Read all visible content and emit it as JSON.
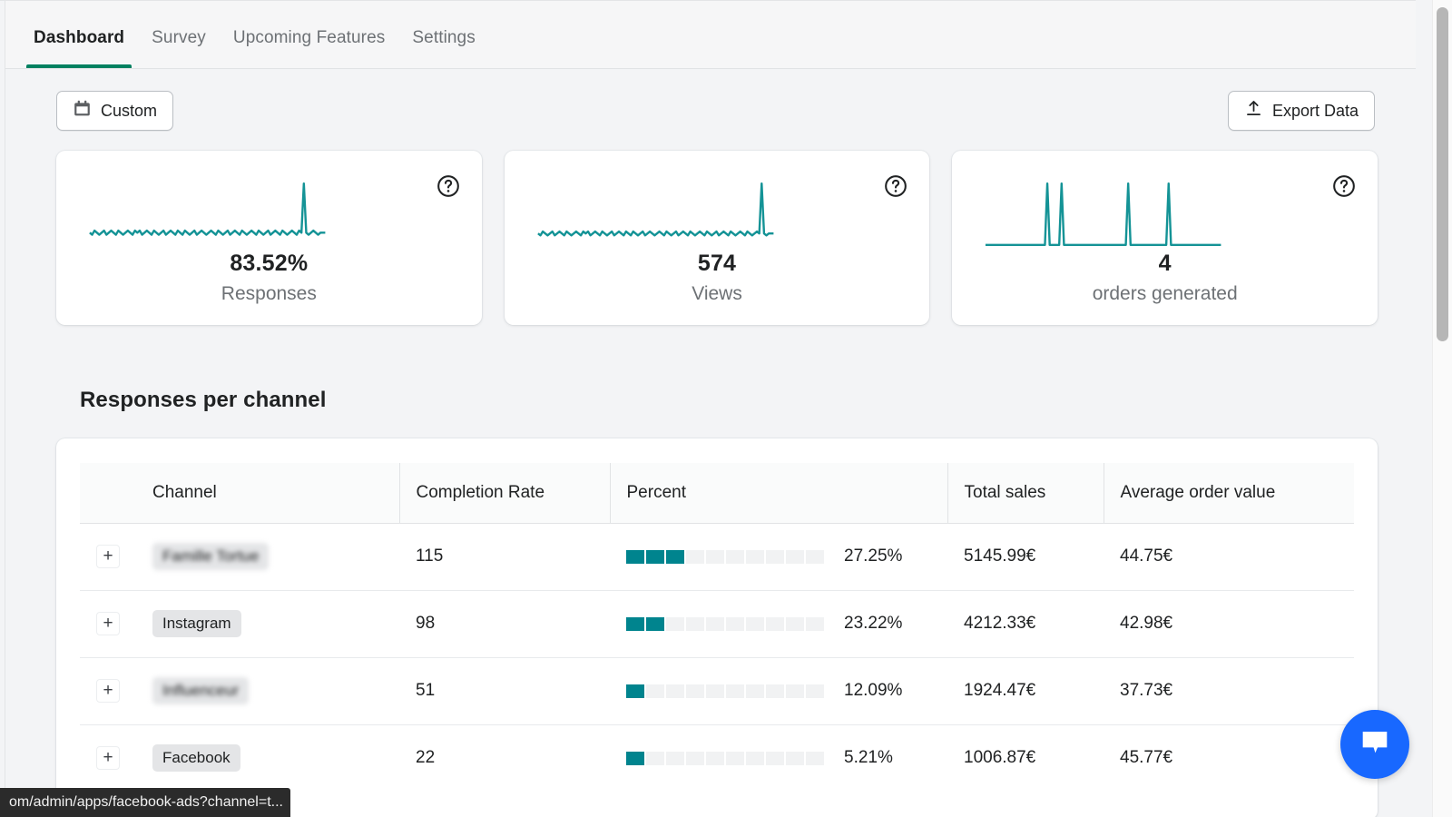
{
  "nav": {
    "tabs": [
      {
        "label": "Dashboard",
        "active": true
      },
      {
        "label": "Survey",
        "active": false
      },
      {
        "label": "Upcoming Features",
        "active": false
      },
      {
        "label": "Settings",
        "active": false
      }
    ],
    "accent_color": "#008060"
  },
  "toolbar": {
    "date_range_label": "Custom",
    "date_range_icon": "calendar-icon",
    "export_label": "Export Data",
    "export_icon": "upload-icon"
  },
  "cards": [
    {
      "value": "83.52%",
      "label": "Responses",
      "help_icon": "question-mark-circle-icon",
      "sparkline_color": "#149396"
    },
    {
      "value": "574",
      "label": "Views",
      "help_icon": "question-mark-circle-icon",
      "sparkline_color": "#149396"
    },
    {
      "value": "4",
      "label": "orders generated",
      "help_icon": "question-mark-circle-icon",
      "sparkline_color": "#149396"
    }
  ],
  "section": {
    "title": "Responses per channel"
  },
  "table": {
    "columns": [
      "Channel",
      "Completion Rate",
      "Percent",
      "Total sales",
      "Average order value"
    ],
    "expand_label": "+",
    "segment_count": 10,
    "rows": [
      {
        "channel": "Famille Tortue",
        "redacted": true,
        "completion_rate": "115",
        "percent": "27.25%",
        "segments_filled": 3,
        "total_sales": "5145.99€",
        "average_order_value": "44.75€"
      },
      {
        "channel": "Instagram",
        "redacted": false,
        "completion_rate": "98",
        "percent": "23.22%",
        "segments_filled": 2,
        "total_sales": "4212.33€",
        "average_order_value": "42.98€"
      },
      {
        "channel": "Influenceur",
        "redacted": true,
        "completion_rate": "51",
        "percent": "12.09%",
        "segments_filled": 1,
        "total_sales": "1924.47€",
        "average_order_value": "37.73€"
      },
      {
        "channel": "Facebook",
        "redacted": false,
        "completion_rate": "22",
        "percent": "5.21%",
        "segments_filled": 1,
        "total_sales": "1006.87€",
        "average_order_value": "45.77€"
      }
    ]
  },
  "chat": {
    "icon": "chat-bubble-icon",
    "color": "#1868ff"
  },
  "status_bar": {
    "url": "om/admin/apps/facebook-ads?channel=t..."
  },
  "chart_data": [
    {
      "type": "line",
      "title": "Responses",
      "value": "83.52%",
      "ylabel": "",
      "xlabel": "",
      "series": [
        {
          "name": "Responses",
          "values": [
            6,
            5,
            7,
            6,
            5,
            6,
            7,
            5,
            6,
            7,
            6,
            5,
            7,
            6,
            5,
            6,
            7,
            6,
            5,
            7,
            6,
            7,
            5,
            6,
            7,
            6,
            5,
            7,
            6,
            5,
            6,
            7,
            5,
            6,
            7,
            6,
            5,
            7,
            6,
            5,
            7,
            6,
            5,
            6,
            7,
            5,
            6,
            7,
            6,
            5,
            6,
            7,
            6,
            5,
            7,
            6,
            5,
            6,
            7,
            5,
            6,
            7,
            6,
            5,
            7,
            6,
            5,
            6,
            7,
            6,
            5,
            7,
            6,
            5,
            6,
            7,
            5,
            6,
            7,
            6,
            5,
            7,
            6,
            5,
            6,
            7,
            6,
            5,
            7,
            6,
            30,
            6,
            5,
            6,
            7,
            6,
            5,
            6,
            6,
            6
          ]
        }
      ]
    },
    {
      "type": "line",
      "title": "Views",
      "value": "574",
      "ylabel": "",
      "xlabel": "",
      "series": [
        {
          "name": "Views",
          "values": [
            6,
            5,
            7,
            6,
            5,
            6,
            7,
            5,
            6,
            7,
            6,
            5,
            7,
            6,
            5,
            6,
            7,
            6,
            5,
            7,
            6,
            7,
            5,
            6,
            7,
            6,
            5,
            7,
            6,
            5,
            6,
            7,
            5,
            6,
            7,
            6,
            5,
            7,
            6,
            5,
            7,
            6,
            5,
            6,
            7,
            5,
            6,
            7,
            6,
            5,
            6,
            7,
            6,
            5,
            7,
            6,
            5,
            6,
            7,
            5,
            6,
            7,
            6,
            5,
            7,
            6,
            5,
            6,
            7,
            6,
            5,
            7,
            6,
            5,
            6,
            7,
            5,
            6,
            7,
            6,
            5,
            7,
            6,
            5,
            6,
            7,
            6,
            5,
            7,
            6,
            5,
            6,
            7,
            6,
            32,
            6,
            5,
            6,
            6,
            6
          ]
        }
      ]
    },
    {
      "type": "line",
      "title": "orders generated",
      "value": "4",
      "ylabel": "",
      "xlabel": "",
      "series": [
        {
          "name": "orders generated",
          "values": [
            0,
            0,
            0,
            0,
            0,
            0,
            0,
            0,
            0,
            0,
            0,
            0,
            0,
            0,
            0,
            0,
            0,
            0,
            0,
            0,
            0,
            0,
            0,
            0,
            0,
            0,
            30,
            0,
            0,
            0,
            0,
            0,
            30,
            0,
            0,
            0,
            0,
            0,
            0,
            0,
            0,
            0,
            0,
            0,
            0,
            0,
            0,
            0,
            0,
            0,
            0,
            0,
            0,
            0,
            0,
            0,
            0,
            0,
            0,
            0,
            30,
            0,
            0,
            0,
            0,
            0,
            0,
            0,
            0,
            0,
            0,
            0,
            0,
            0,
            0,
            0,
            0,
            30,
            0,
            0,
            0,
            0,
            0,
            0,
            0,
            0,
            0,
            0,
            0,
            0,
            0,
            0,
            0,
            0,
            0,
            0,
            0,
            0,
            0,
            0
          ]
        }
      ]
    },
    {
      "type": "bar",
      "title": "Responses per channel",
      "categories": [
        "Famille Tortue",
        "Instagram",
        "Influenceur",
        "Facebook"
      ],
      "values": [
        115,
        98,
        51,
        22
      ],
      "percent_values": [
        27.25,
        23.22,
        12.09,
        5.21
      ],
      "total_sales": [
        5145.99,
        4212.33,
        1924.47,
        1006.87
      ],
      "average_order_value": [
        44.75,
        42.98,
        37.73,
        45.77
      ],
      "xlabel": "Channel",
      "ylabel": "Completion Rate"
    }
  ]
}
